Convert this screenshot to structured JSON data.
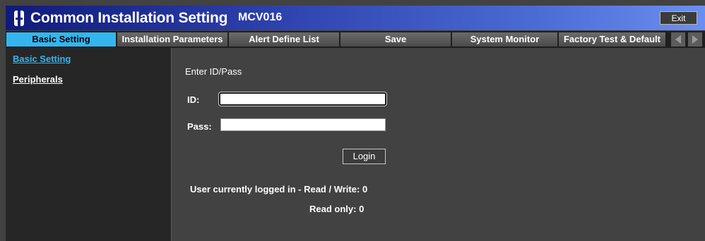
{
  "titlebar": {
    "app_title": "Common Installation Setting",
    "model": "MCV016",
    "exit_label": "Exit"
  },
  "tabs": [
    {
      "label": "Basic Setting",
      "active": true
    },
    {
      "label": "Installation Parameters",
      "active": false
    },
    {
      "label": "Alert Define List",
      "active": false
    },
    {
      "label": "Save",
      "active": false
    },
    {
      "label": "System Monitor",
      "active": false
    },
    {
      "label": "Factory Test & Default",
      "active": false
    }
  ],
  "sidebar": {
    "items": [
      {
        "label": "Basic Setting",
        "active": true
      },
      {
        "label": "Peripherals",
        "active": false
      }
    ]
  },
  "login": {
    "heading": "Enter ID/Pass",
    "id_label": "ID:",
    "id_value": "",
    "pass_label": "Pass:",
    "pass_value": "",
    "login_label": "Login",
    "rw_label": "User currently logged in - Read / Write:",
    "rw_count": "0",
    "ro_label": "Read only:",
    "ro_count": "0"
  },
  "colors": {
    "active_tab": "#33b6ef",
    "active_link": "#33b6ef",
    "title_gradient_start": "#101a7a",
    "title_gradient_end": "#6b8ff0"
  },
  "icons": {
    "logo": "brand-logo-icon",
    "scroll_left": "arrow-left-icon",
    "scroll_right": "arrow-right-icon"
  }
}
